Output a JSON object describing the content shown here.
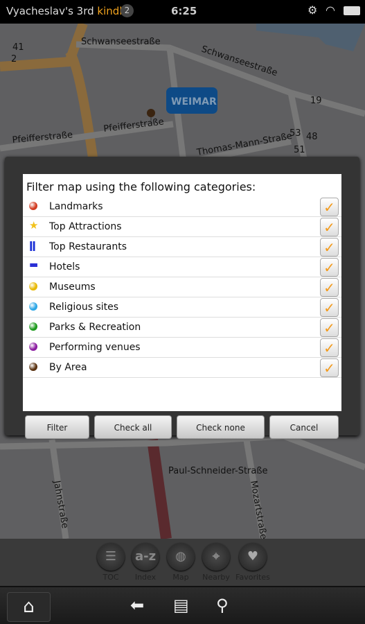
{
  "status": {
    "device_name": "Vyacheslav's 3rd",
    "brand": "kindle",
    "notification_count": "2",
    "time": "6:25",
    "icons": [
      "gear-icon",
      "wifi-icon",
      "battery-icon"
    ]
  },
  "map": {
    "labels": [
      "Schwanseestraße",
      "Schwanseestraße",
      "Pfeifferstraße",
      "Pfeifferstraße",
      "Thomas-Mann-Straße",
      "Paul-Schneider-Straße",
      "Jahnstraße",
      "Mozartstraße",
      "41",
      "2",
      "19",
      "53",
      "48",
      "51"
    ],
    "marker": "WEIMAR"
  },
  "dialog": {
    "title": "Filter map using the following categories:",
    "categories": [
      {
        "label": "Landmarks",
        "icon": "red-dot-icon",
        "color": "#d23a1f",
        "checked": true
      },
      {
        "label": "Top Attractions",
        "icon": "star-icon",
        "color": "#f2c21a",
        "checked": true
      },
      {
        "label": "Top Restaurants",
        "icon": "fork-knife-icon",
        "color": "#1a2fd6",
        "checked": true
      },
      {
        "label": "Hotels",
        "icon": "bed-icon",
        "color": "#2a2fd6",
        "checked": true
      },
      {
        "label": "Museums",
        "icon": "yellow-dot-icon",
        "color": "#e8b800",
        "checked": true
      },
      {
        "label": "Religious sites",
        "icon": "blue-dot-icon",
        "color": "#2ba6e6",
        "checked": true
      },
      {
        "label": "Parks & Recreation",
        "icon": "green-dot-icon",
        "color": "#1b9a1b",
        "checked": true
      },
      {
        "label": "Performing venues",
        "icon": "purple-dot-icon",
        "color": "#8a1aa0",
        "checked": true
      },
      {
        "label": "By Area",
        "icon": "brown-dot-icon",
        "color": "#5a3210",
        "checked": true
      }
    ],
    "buttons": {
      "filter": "Filter",
      "check_all": "Check all",
      "check_none": "Check none",
      "cancel": "Cancel"
    }
  },
  "toolbar": {
    "toc": "TOC",
    "index": "Index",
    "index_glyph": "a-z",
    "map": "Map",
    "nearby": "Nearby",
    "favorites": "Favorites"
  }
}
